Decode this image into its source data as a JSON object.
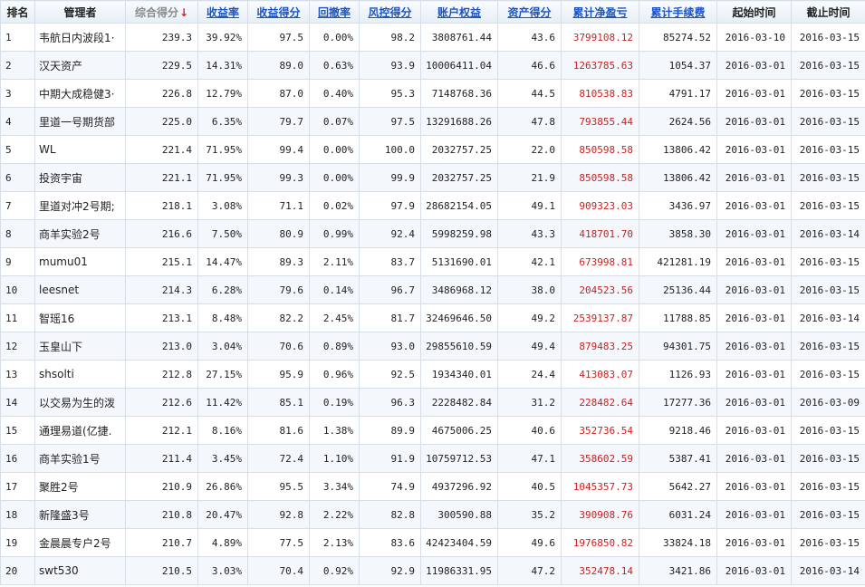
{
  "columns": [
    {
      "label": "排名"
    },
    {
      "label": "管理者"
    },
    {
      "label": "综合得分",
      "arrow": "↓"
    },
    {
      "label": "收益率"
    },
    {
      "label": "收益得分"
    },
    {
      "label": "回撤率"
    },
    {
      "label": "风控得分"
    },
    {
      "label": "账户权益"
    },
    {
      "label": "资产得分"
    },
    {
      "label": "累计净盈亏"
    },
    {
      "label": "累计手续费"
    },
    {
      "label": "起始时间"
    },
    {
      "label": "截止时间"
    }
  ],
  "rows": [
    [
      "1",
      "韦航日内波段1·",
      "239.3",
      "39.92%",
      "97.5",
      "0.00%",
      "98.2",
      "3808761.44",
      "43.6",
      "3799108.12",
      "85274.52",
      "2016-03-10",
      "2016-03-15"
    ],
    [
      "2",
      "汉天资产",
      "229.5",
      "14.31%",
      "89.0",
      "0.63%",
      "93.9",
      "10006411.04",
      "46.6",
      "1263785.63",
      "1054.37",
      "2016-03-01",
      "2016-03-15"
    ],
    [
      "3",
      "中期大成稳健3·",
      "226.8",
      "12.79%",
      "87.0",
      "0.40%",
      "95.3",
      "7148768.36",
      "44.5",
      "810538.83",
      "4791.17",
      "2016-03-01",
      "2016-03-15"
    ],
    [
      "4",
      "里道一号期货部",
      "225.0",
      "6.35%",
      "79.7",
      "0.07%",
      "97.5",
      "13291688.26",
      "47.8",
      "793855.44",
      "2624.56",
      "2016-03-01",
      "2016-03-15"
    ],
    [
      "5",
      "WL",
      "221.4",
      "71.95%",
      "99.4",
      "0.00%",
      "100.0",
      "2032757.25",
      "22.0",
      "850598.58",
      "13806.42",
      "2016-03-01",
      "2016-03-15"
    ],
    [
      "6",
      "投资宇宙",
      "221.1",
      "71.95%",
      "99.3",
      "0.00%",
      "99.9",
      "2032757.25",
      "21.9",
      "850598.58",
      "13806.42",
      "2016-03-01",
      "2016-03-15"
    ],
    [
      "7",
      "里道对冲2号期;",
      "218.1",
      "3.08%",
      "71.1",
      "0.02%",
      "97.9",
      "28682154.05",
      "49.1",
      "909323.03",
      "3436.97",
      "2016-03-01",
      "2016-03-15"
    ],
    [
      "8",
      "商羊实验2号",
      "216.6",
      "7.50%",
      "80.9",
      "0.99%",
      "92.4",
      "5998259.98",
      "43.3",
      "418701.70",
      "3858.30",
      "2016-03-01",
      "2016-03-14"
    ],
    [
      "9",
      "mumu01",
      "215.1",
      "14.47%",
      "89.3",
      "2.11%",
      "83.7",
      "5131690.01",
      "42.1",
      "673998.81",
      "421281.19",
      "2016-03-01",
      "2016-03-15"
    ],
    [
      "10",
      "leesnet",
      "214.3",
      "6.28%",
      "79.6",
      "0.14%",
      "96.7",
      "3486968.12",
      "38.0",
      "204523.56",
      "25136.44",
      "2016-03-01",
      "2016-03-15"
    ],
    [
      "11",
      "智瑶16",
      "213.1",
      "8.48%",
      "82.2",
      "2.45%",
      "81.7",
      "32469646.50",
      "49.2",
      "2539137.87",
      "11788.85",
      "2016-03-01",
      "2016-03-14"
    ],
    [
      "12",
      "玉皇山下",
      "213.0",
      "3.04%",
      "70.6",
      "0.89%",
      "93.0",
      "29855610.59",
      "49.4",
      "879483.25",
      "94301.75",
      "2016-03-01",
      "2016-03-15"
    ],
    [
      "13",
      "shsolti",
      "212.8",
      "27.15%",
      "95.9",
      "0.96%",
      "92.5",
      "1934340.01",
      "24.4",
      "413083.07",
      "1126.93",
      "2016-03-01",
      "2016-03-15"
    ],
    [
      "14",
      "以交易为生的泼",
      "212.6",
      "11.42%",
      "85.1",
      "0.19%",
      "96.3",
      "2228482.84",
      "31.2",
      "228482.64",
      "17277.36",
      "2016-03-01",
      "2016-03-09"
    ],
    [
      "15",
      "通理易道(亿捷.",
      "212.1",
      "8.16%",
      "81.6",
      "1.38%",
      "89.9",
      "4675006.25",
      "40.6",
      "352736.54",
      "9218.46",
      "2016-03-01",
      "2016-03-15"
    ],
    [
      "16",
      "商羊实验1号",
      "211.4",
      "3.45%",
      "72.4",
      "1.10%",
      "91.9",
      "10759712.53",
      "47.1",
      "358602.59",
      "5387.41",
      "2016-03-01",
      "2016-03-15"
    ],
    [
      "17",
      "聚胜2号",
      "210.9",
      "26.86%",
      "95.5",
      "3.34%",
      "74.9",
      "4937296.92",
      "40.5",
      "1045357.73",
      "5642.27",
      "2016-03-01",
      "2016-03-15"
    ],
    [
      "18",
      "新隆盛3号",
      "210.8",
      "20.47%",
      "92.8",
      "2.22%",
      "82.8",
      "300590.88",
      "35.2",
      "390908.76",
      "6031.24",
      "2016-03-01",
      "2016-03-15"
    ],
    [
      "19",
      "金晨晨专户2号",
      "210.7",
      "4.89%",
      "77.5",
      "2.13%",
      "83.6",
      "42423404.59",
      "49.6",
      "1976850.82",
      "33824.18",
      "2016-03-01",
      "2016-03-15"
    ],
    [
      "20",
      "swt530",
      "210.5",
      "3.03%",
      "70.4",
      "0.92%",
      "92.9",
      "11986331.95",
      "47.2",
      "352478.14",
      "3421.86",
      "2016-03-01",
      "2016-03-14"
    ]
  ]
}
